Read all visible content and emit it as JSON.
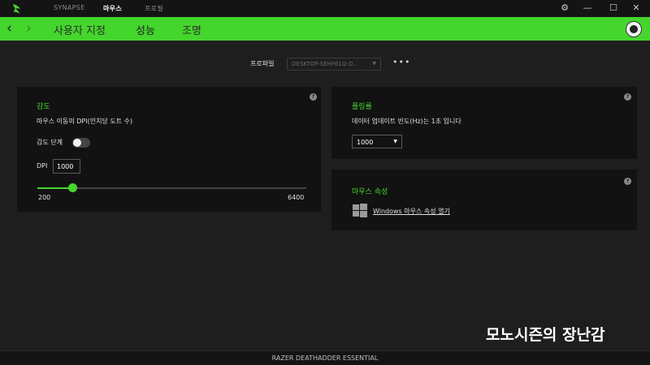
{
  "titlebar": {
    "tabs": [
      {
        "label": "SYNAPSE",
        "active": false
      },
      {
        "label": "마우스",
        "active": true
      },
      {
        "label": "프로필",
        "active": false
      }
    ],
    "icons": [
      "razer-logo-icon",
      "gear-icon",
      "minimize-icon",
      "maximize-icon",
      "close-icon"
    ]
  },
  "navbar": {
    "back_icon": "chevron-left-icon",
    "forward_icon": "chevron-right-icon",
    "items": [
      {
        "label": "사용자 지정",
        "active": false
      },
      {
        "label": "성능",
        "active": true
      },
      {
        "label": "조명",
        "active": false
      }
    ],
    "accent": "#44d62c"
  },
  "profile": {
    "label": "프로파일",
    "value": "DESKTOP-5EHF61Q-D...",
    "more": "•••"
  },
  "sensitivity": {
    "title": "감도",
    "description": "마우스 이동의 DPI(인치당 도트 수)",
    "stages_label": "감도 단계",
    "stages_enabled": false,
    "dpi_label": "DPI",
    "dpi_value": "1000",
    "slider_min": "200",
    "slider_max": "6400",
    "slider_value": 1000,
    "help": "?"
  },
  "polling": {
    "title": "폴링률",
    "description": "데이터 업데이트 빈도(Hz)는 1초 입니다",
    "value": "1000",
    "help": "?"
  },
  "mouse_props": {
    "title": "마우스 속성",
    "link": "Windows 마우스 속성 열기",
    "icon": "windows-logo-icon",
    "help": "?"
  },
  "watermark": "모노시즌의 장난감",
  "statusbar": {
    "device": "RAZER DEATHADDER ESSENTIAL"
  }
}
